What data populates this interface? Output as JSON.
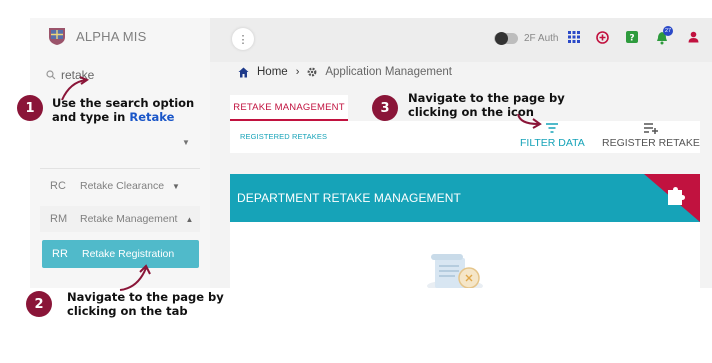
{
  "colors": {
    "accent": "#16a3b8",
    "brand_red": "#c1123f",
    "annotation_badge": "#8a1538"
  },
  "sidebar": {
    "brand_name": "ALPHA MIS",
    "search_value": "retake",
    "items": [
      {
        "abbr": "RC",
        "label": "Retake Clearance",
        "expanded": false
      },
      {
        "abbr": "RM",
        "label": "Retake Management",
        "expanded": true
      },
      {
        "abbr": "RR",
        "label": "Retake Registration",
        "active": true
      }
    ]
  },
  "topbar": {
    "auth_label": "2F Auth",
    "notification_count": "27",
    "icons": [
      "menu-dots-icon",
      "toggle-switch",
      "grid-icon",
      "add-circle-icon",
      "help-icon",
      "bell-icon",
      "user-icon"
    ]
  },
  "breadcrumb": {
    "home": "Home",
    "current": "Application Management"
  },
  "tabs": {
    "active": "RETAKE MANAGEMENT",
    "sub": "REGISTERED RETAKES"
  },
  "actions": {
    "filter": "FILTER DATA",
    "register": "REGISTER RETAKE"
  },
  "card": {
    "title": "DEPARTMENT RETAKE MANAGEMENT"
  },
  "annotations": [
    {
      "number": "1",
      "line1": "Use the search option",
      "line2_prefix": "and type in ",
      "line2_highlight": "Retake"
    },
    {
      "number": "2",
      "line1": "Navigate to the page by",
      "line2": "clicking on the tab"
    },
    {
      "number": "3",
      "line1": "Navigate to the page by",
      "line2": "clicking on the icon"
    }
  ]
}
